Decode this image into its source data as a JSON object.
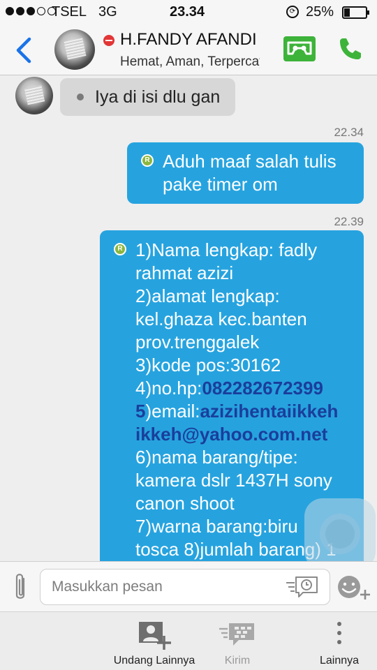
{
  "status_bar": {
    "carrier": "TSEL",
    "network": "3G",
    "time": "23.34",
    "battery_percent": "25%",
    "signal_bars_filled": 3,
    "signal_bars_total": 5
  },
  "header": {
    "contact_name": "H.FANDY AFANDI",
    "contact_status": "Hemat, Aman, Terpercaya"
  },
  "messages": {
    "incoming_1": "Iya di isi dlu gan",
    "ts_1": "22.34",
    "outgoing_1": {
      "badge": "R",
      "lines": [
        "Aduh maaf salah tulis",
        "pake timer om"
      ]
    },
    "ts_2": "22.39",
    "outgoing_2": {
      "badge": "R",
      "l1": "1)Nama lengkap: fadly",
      "l2": "rahmat azizi",
      "l3": "2)alamat lengkap:",
      "l4": "kel.ghaza kec.banten",
      "l5": "prov.trenggalek",
      "l6": "3)kode pos:30162",
      "l7_label": "4)no.hp:",
      "l7_phone": "082282672399",
      "l8_num": "5",
      "l8_label": ")email:",
      "l8_email_a": "azizihentaiikkeh",
      "l9_email_b": "ikkeh@yahoo.com.net",
      "l10": "6)nama barang/tipe:",
      "l11": "kamera dslr 1437H sony",
      "l12": "canon shoot",
      "l13": "7)warna barang:biru",
      "l14": "tosca 8)jumlah barang) 1"
    }
  },
  "input": {
    "placeholder": "Masukkan pesan"
  },
  "toolbar": {
    "invite_label": "Undang Lainnya",
    "send_label": "Kirim",
    "more_label": "Lainnya"
  },
  "colors": {
    "outgoing_bubble": "#26a3df",
    "incoming_bubble": "#d7d7d7",
    "accent_blue": "#1a73e8",
    "accent_green": "#3db33a",
    "link": "#1a3e9c"
  },
  "icons": [
    "back-icon",
    "do-not-disturb-icon",
    "timer-message-icon",
    "phone-icon",
    "paperclip-icon",
    "timer-clock-icon",
    "emoji-add-icon",
    "invite-contact-icon",
    "bbm-icon",
    "more-vertical-icon"
  ]
}
